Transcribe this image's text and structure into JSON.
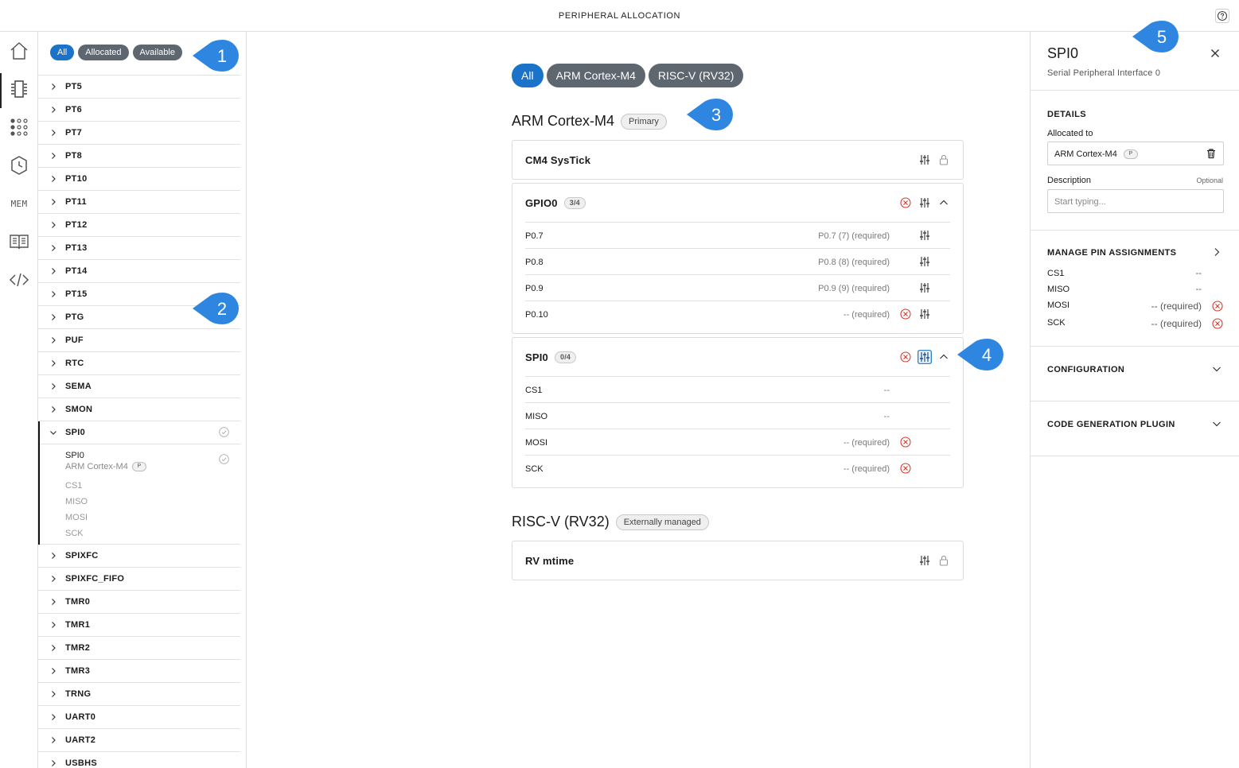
{
  "window": {
    "title": "PERIPHERAL ALLOCATION",
    "help_icon": "help-circle-icon"
  },
  "rail": {
    "icons": [
      "home-icon",
      "peripheral-allocation-icon",
      "pin-config-icon",
      "clock-config-icon",
      "memory-icon",
      "docs-icon",
      "code-icon"
    ],
    "mem_label": "MEM"
  },
  "tree": {
    "filters": [
      "All",
      "Allocated",
      "Available"
    ],
    "items_before": [
      "PT5",
      "PT6",
      "PT7",
      "PT8",
      "PT10",
      "PT11",
      "PT12",
      "PT13",
      "PT14",
      "PT15",
      "PTG",
      "PUF",
      "RTC",
      "SEMA",
      "SMON"
    ],
    "expanded": {
      "label": "SPI0",
      "sub_title": "SPI0",
      "sub_core": "ARM Cortex-M4",
      "sub_badge": "P",
      "pins": [
        "CS1",
        "MISO",
        "MOSI",
        "SCK"
      ]
    },
    "items_after": [
      "SPIXFC",
      "SPIXFC_FIFO",
      "TMR0",
      "TMR1",
      "TMR2",
      "TMR3",
      "TRNG",
      "UART0",
      "UART2",
      "USBHS"
    ]
  },
  "main": {
    "core_filters": [
      "All",
      "ARM Cortex-M4",
      "RISC-V (RV32)"
    ],
    "sections": [
      {
        "name": "ARM Cortex-M4",
        "tag": "Primary",
        "cards": [
          {
            "name": "CM4 SysTick"
          },
          {
            "name": "GPIO0",
            "count": "3/4",
            "pins": [
              {
                "name": "P0.7",
                "value": "P0.7 (7) (required)"
              },
              {
                "name": "P0.8",
                "value": "P0.8 (8) (required)"
              },
              {
                "name": "P0.9",
                "value": "P0.9 (9) (required)"
              },
              {
                "name": "P0.10",
                "value": "-- (required)"
              }
            ]
          },
          {
            "name": "SPI0",
            "count": "0/4",
            "pins": [
              {
                "name": "CS1",
                "value": "--"
              },
              {
                "name": "MISO",
                "value": "--"
              },
              {
                "name": "MOSI",
                "value": "-- (required)"
              },
              {
                "name": "SCK",
                "value": "-- (required)"
              }
            ]
          }
        ]
      },
      {
        "name": "RISC-V (RV32)",
        "tag": "Externally managed",
        "cards": [
          {
            "name": "RV mtime"
          }
        ]
      }
    ]
  },
  "callouts": [
    "1",
    "2",
    "3",
    "4",
    "5"
  ],
  "details": {
    "title": "SPI0",
    "subtitle": "Serial Peripheral Interface 0",
    "details_heading": "DETAILS",
    "allocated_label": "Allocated to",
    "allocated_value": "ARM Cortex-M4",
    "allocated_badge": "P",
    "description_label": "Description",
    "description_optional": "Optional",
    "description_placeholder": "Start typing...",
    "pin_heading": "MANAGE PIN ASSIGNMENTS",
    "pin_assignments": [
      {
        "name": "CS1",
        "value": "--"
      },
      {
        "name": "MISO",
        "value": "--"
      },
      {
        "name": "MOSI",
        "value": "-- (required)"
      },
      {
        "name": "SCK",
        "value": "-- (required)"
      }
    ],
    "configuration_heading": "CONFIGURATION",
    "codegen_heading": "CODE GENERATION PLUGIN"
  },
  "colors": {
    "accent": "#1a73c8",
    "pill_gray": "#5e6670",
    "error": "#d9372b",
    "callout": "#2f86e0"
  }
}
